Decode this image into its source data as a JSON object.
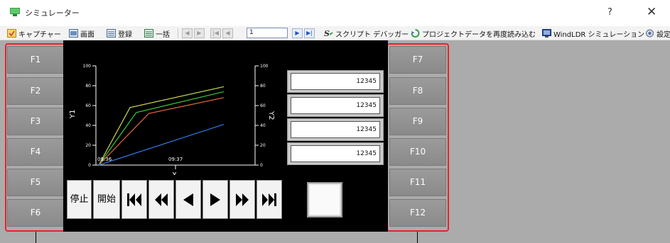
{
  "window": {
    "title": "シミュレーター",
    "help": "?",
    "close": "✕"
  },
  "toolbar": {
    "capture": "キャプチャー",
    "screen": "画面",
    "register": "登録",
    "bulk": "一括",
    "page_value": "1",
    "script_debugger": "スクリプト デバッガー",
    "reload_project": "プロジェクトデータを再度読み込む",
    "windldr_sim": "WindLDR シミュレーション",
    "settings": "設定"
  },
  "function_keys": {
    "left": [
      "F1",
      "F2",
      "F3",
      "F4",
      "F5",
      "F6"
    ],
    "right": [
      "F7",
      "F8",
      "F9",
      "F10",
      "F11",
      "F12"
    ]
  },
  "trend": {
    "y1_label": "Y1",
    "y2_label": "Y2",
    "x_label": "X",
    "y1_ticks": [
      "100",
      "80",
      "60",
      "40",
      "20",
      "0"
    ],
    "y2_ticks": [
      "100",
      "80",
      "60",
      "40",
      "20",
      "0"
    ],
    "time_labels": [
      "09:36",
      "09:37"
    ],
    "series_colors": [
      "#c8d850",
      "#38c838",
      "#e8663c",
      "#3278e6"
    ]
  },
  "chart_data": {
    "type": "line",
    "xlabel": "X",
    "ylabel": "Y1",
    "y2label": "Y2",
    "ylim": [
      0,
      100
    ],
    "x_ticks": [
      "09:36",
      "09:37"
    ],
    "series": [
      {
        "points": [
          [
            0,
            0
          ],
          [
            0.25,
            58
          ],
          [
            1,
            79
          ]
        ]
      },
      {
        "points": [
          [
            0,
            0
          ],
          [
            0.3,
            53
          ],
          [
            1,
            74
          ]
        ]
      },
      {
        "points": [
          [
            0,
            0
          ],
          [
            0.4,
            52
          ],
          [
            1,
            68
          ]
        ]
      },
      {
        "points": [
          [
            0,
            0
          ],
          [
            1,
            41
          ]
        ]
      }
    ]
  },
  "readouts": [
    "12345",
    "12345",
    "12345",
    "12345"
  ],
  "controls": {
    "stop": "停止",
    "start": "開始"
  }
}
